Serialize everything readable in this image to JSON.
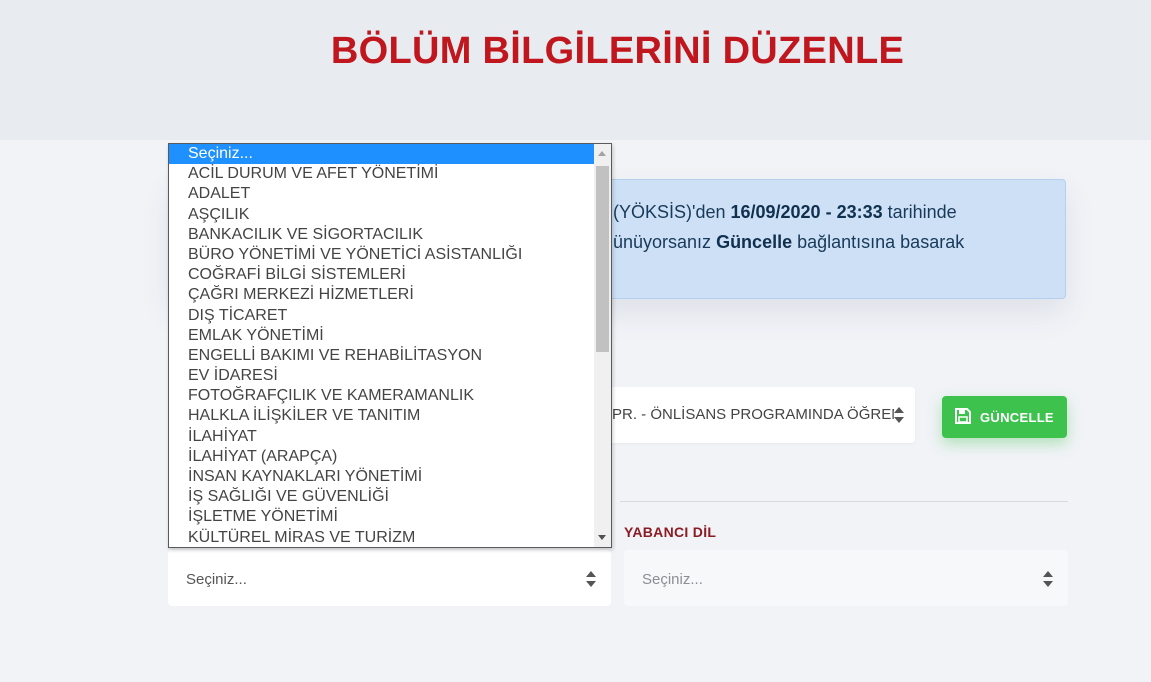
{
  "page": {
    "title": "BÖLÜM BİLGİLERİNİ DÜZENLE"
  },
  "info_box": {
    "line1_a": "(YÖKSİS)'den ",
    "line1_b": "16/09/2020 - 23:33",
    "line1_c": " tarihinde",
    "line2_a": "ünüyorsanız ",
    "line2_b": "Güncelle",
    "line2_c": " bağlantısına basarak"
  },
  "program_select": {
    "value": "PR. - ÖNLİSANS PROGRAMINDA ÖĞRENCİ"
  },
  "update_button": {
    "label": "GÜNCELLE"
  },
  "department_select": {
    "value": "Seçiniz..."
  },
  "language": {
    "label": "YABANCI DİL",
    "value": "Seçiniz..."
  },
  "dropdown": {
    "options": [
      "Seçiniz...",
      "ACİL DURUM VE AFET YÖNETİMİ",
      "ADALET",
      "AŞÇILIK",
      "BANKACILIK VE SİGORTACILIK",
      "BÜRO YÖNETİMİ VE YÖNETİCİ ASİSTANLIĞI",
      "COĞRAFİ BİLGİ SİSTEMLERİ",
      "ÇAĞRI MERKEZİ HİZMETLERİ",
      "DIŞ TİCARET",
      "EMLAK YÖNETİMİ",
      "ENGELLİ BAKIMI VE REHABİLİTASYON",
      "EV İDARESİ",
      "FOTOĞRAFÇILIK VE KAMERAMANLIK",
      "HALKLA İLİŞKİLER VE TANITIM",
      "İLAHİYAT",
      "İLAHİYAT (ARAPÇA)",
      "İNSAN KAYNAKLARI YÖNETİMİ",
      "İŞ SAĞLIĞI VE GÜVENLİĞİ",
      "İŞLETME YÖNETİMİ",
      "KÜLTÜREL MİRAS VE TURİZM"
    ]
  },
  "colors": {
    "title": "#c0161d",
    "info_bg": "#cde0f5",
    "button_green": "#3ec24e",
    "dropdown_highlight": "#1e90ff",
    "label_red": "#8a1c24"
  },
  "icons": {
    "save": "floppy-disk-icon",
    "select": "updown-arrows-icon"
  }
}
